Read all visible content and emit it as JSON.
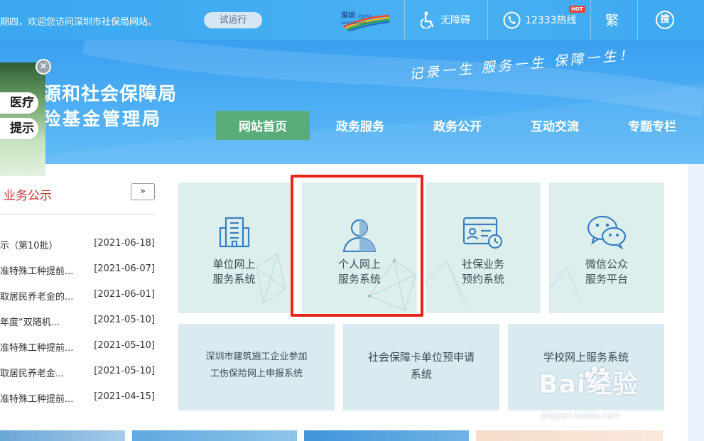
{
  "topbar": {
    "welcome": "期四，欢迎您访问深圳市社保局网站。",
    "trial_label": "试运行",
    "accessibility_label": "无障碍",
    "hotline_label": "12333热线",
    "hot_badge": "HOT",
    "traditional_label": "繁",
    "search_label": "搜"
  },
  "header": {
    "org_name_1": "源和社会保障局",
    "org_name_2": "险基金管理局",
    "slogan": "记录一生 服务一生 保障一生！"
  },
  "nav": {
    "items": [
      {
        "label": "网站首页",
        "active": true
      },
      {
        "label": "政务服务"
      },
      {
        "label": "政务公开"
      },
      {
        "label": "互动交流"
      },
      {
        "label": "专题专栏"
      }
    ]
  },
  "ad": {
    "line1": "医疗",
    "line2": "提示",
    "close": "×"
  },
  "news": {
    "title": "业务公示",
    "more": "»",
    "items": [
      {
        "title": "示（第10批）",
        "date": "[2021-06-18]"
      },
      {
        "title": "准特殊工种提前...",
        "date": "[2021-06-07]"
      },
      {
        "title": "取居民养老金的...",
        "date": "[2021-06-01]"
      },
      {
        "title": "年度“双随机...",
        "date": "[2021-05-10]"
      },
      {
        "title": "准特殊工种提前...",
        "date": "[2021-05-10]"
      },
      {
        "title": "取居民养老金...",
        "date": "[2021-05-10]"
      },
      {
        "title": "准特殊工种提前...",
        "date": "[2021-04-15]"
      }
    ]
  },
  "services": {
    "unit": {
      "line1": "单位网上",
      "line2": "服务系统",
      "icon": "building-icon"
    },
    "personal": {
      "line1": "个人网上",
      "line2": "服务系统",
      "icon": "person-icon"
    },
    "appointment": {
      "line1": "社保业务",
      "line2": "预约系统",
      "icon": "id-card-clock-icon"
    },
    "wechat": {
      "line1": "微信公众",
      "line2": "服务平台",
      "icon": "wechat-icon"
    },
    "construction": {
      "line1": "深圳市建筑施工企业参加",
      "line2": "工伤保险网上申报系统"
    },
    "card": {
      "line1": "社会保障卡单位预申请",
      "line2": "系统"
    },
    "school": {
      "line1": "学校网上服务系统"
    }
  },
  "watermark": {
    "brand": "Bai经验",
    "url": "jingyan.baidu.com"
  },
  "colors": {
    "topbar": "#49b1f3",
    "nav_active": "#59ad78",
    "highlight": "#e8241b",
    "news_title": "#c53434",
    "tile_green": "#dcefec",
    "tile_blue": "#d9eaf1",
    "icon_blue": "#3a7fc1"
  }
}
